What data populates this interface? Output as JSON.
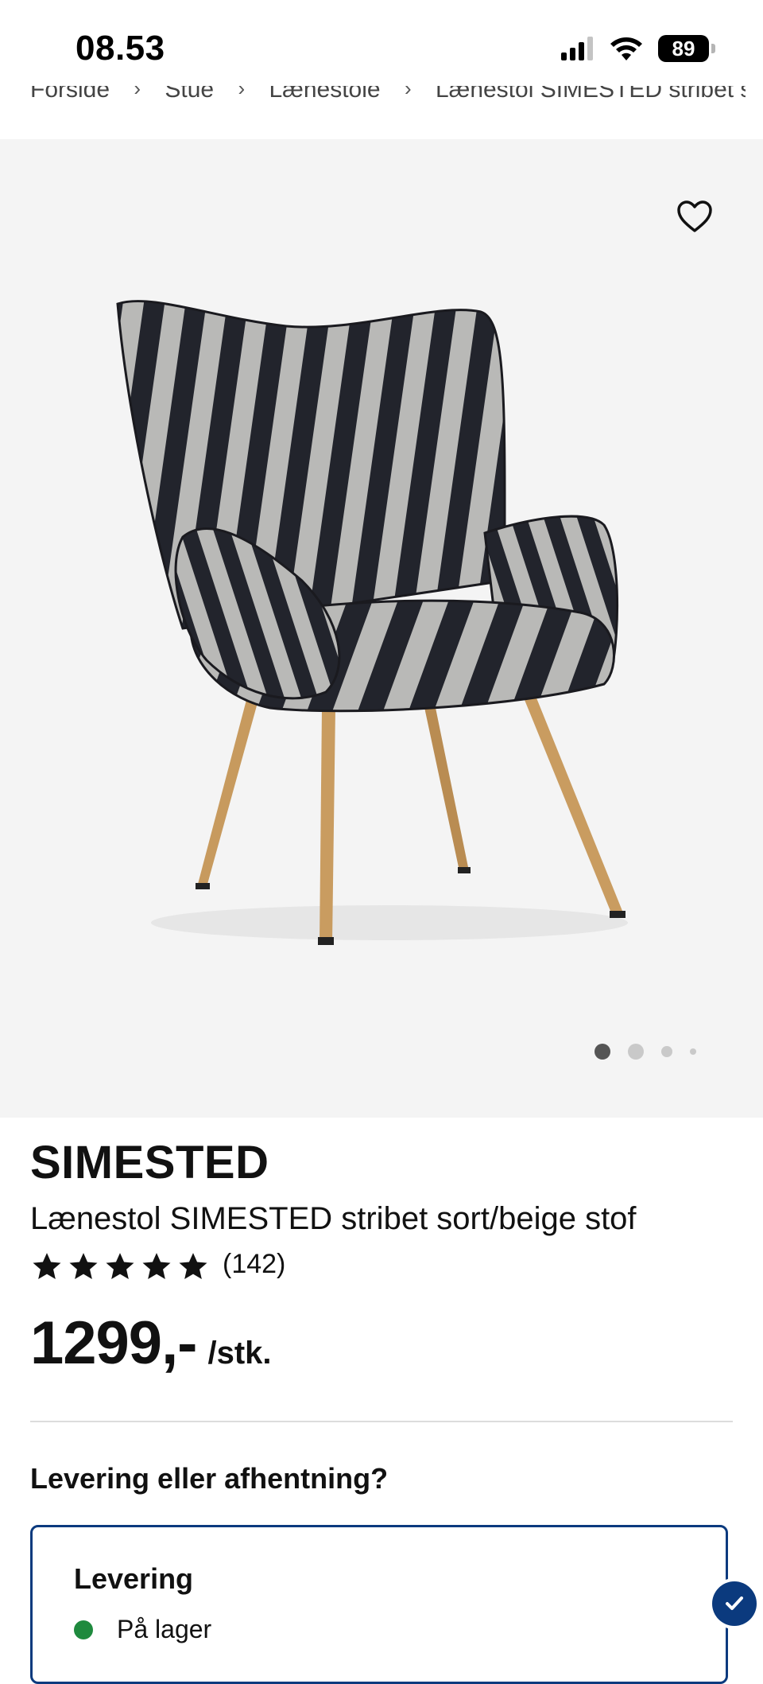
{
  "status_bar": {
    "time": "08.53",
    "battery_level": "89",
    "icons": [
      "cellular-signal-icon",
      "wifi-icon",
      "battery-icon"
    ]
  },
  "breadcrumb": {
    "items": [
      "Forside",
      "Stue",
      "Lænestole",
      "Lænestol SIMESTED stribet sort/beige stof"
    ],
    "separator_icon": "chevron-right-icon"
  },
  "gallery": {
    "favorite_icon": "heart-outline-icon",
    "image_count": 4,
    "active_index": 0
  },
  "product": {
    "brand": "SIMESTED",
    "name": "Lænestol SIMESTED stribet sort/beige stof",
    "rating_stars": 5,
    "review_count": "(142)",
    "price": "1299,-",
    "price_unit": "/stk."
  },
  "delivery": {
    "heading": "Levering eller afhentning?",
    "option_title": "Levering",
    "stock_status": "På lager",
    "stock_color": "#1f8a3e",
    "selected": true,
    "accent_color": "#0b3a7e"
  }
}
